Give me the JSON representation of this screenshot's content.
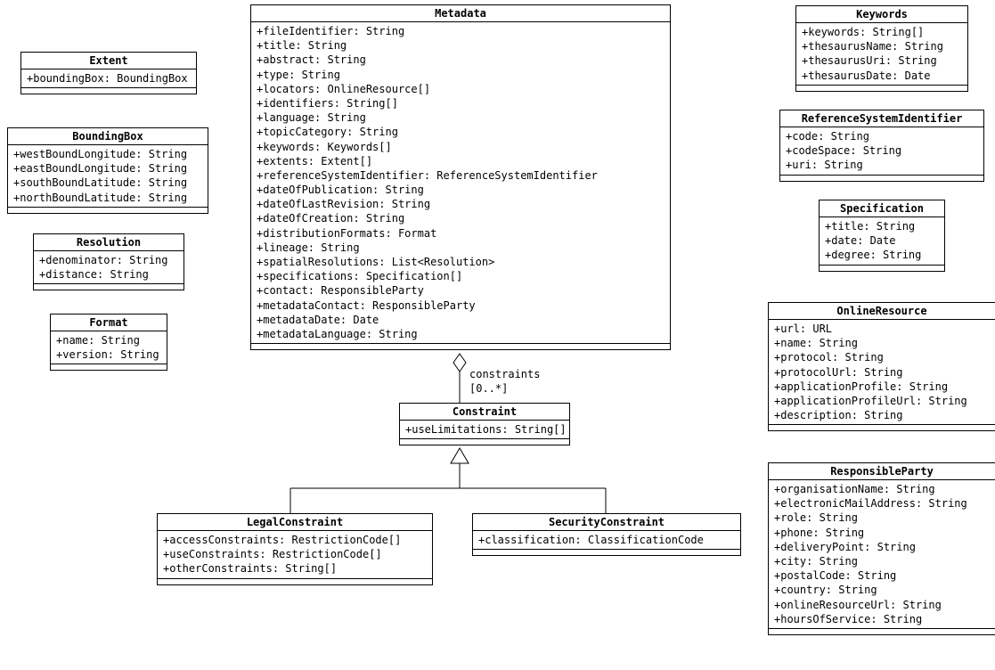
{
  "classes": {
    "metadata": {
      "name": "Metadata",
      "attrs": [
        "+fileIdentifier: String",
        "+title: String",
        "+abstract: String",
        "+type: String",
        "+locators: OnlineResource[]",
        "+identifiers: String[]",
        "+language: String",
        "+topicCategory: String",
        "+keywords: Keywords[]",
        "+extents: Extent[]",
        "+referenceSystemIdentifier: ReferenceSystemIdentifier",
        "+dateOfPublication: String",
        "+dateOfLastRevision: String",
        "+dateOfCreation: String",
        "+distributionFormats: Format",
        "+lineage: String",
        "+spatialResolutions: List<Resolution>",
        "+specifications: Specification[]",
        "+contact: ResponsibleParty",
        "+metadataContact: ResponsibleParty",
        "+metadataDate: Date",
        "+metadataLanguage: String"
      ]
    },
    "extent": {
      "name": "Extent",
      "attrs": [
        "+boundingBox: BoundingBox"
      ]
    },
    "boundingbox": {
      "name": "BoundingBox",
      "attrs": [
        "+westBoundLongitude: String",
        "+eastBoundLongitude: String",
        "+southBoundLatitude: String",
        "+northBoundLatitude: String"
      ]
    },
    "resolution": {
      "name": "Resolution",
      "attrs": [
        "+denominator: String",
        "+distance: String"
      ]
    },
    "format": {
      "name": "Format",
      "attrs": [
        "+name: String",
        "+version: String"
      ]
    },
    "constraint": {
      "name": "Constraint",
      "attrs": [
        "+useLimitations: String[]"
      ]
    },
    "legalconstraint": {
      "name": "LegalConstraint",
      "attrs": [
        "+accessConstraints: RestrictionCode[]",
        "+useConstraints: RestrictionCode[]",
        "+otherConstraints: String[]"
      ]
    },
    "securityconstraint": {
      "name": "SecurityConstraint",
      "attrs": [
        "+classification: ClassificationCode"
      ]
    },
    "keywords": {
      "name": "Keywords",
      "attrs": [
        "+keywords: String[]",
        "+thesaurusName: String",
        "+thesaurusUri: String",
        "+thesaurusDate: Date"
      ]
    },
    "refsys": {
      "name": "ReferenceSystemIdentifier",
      "attrs": [
        "+code: String",
        "+codeSpace: String",
        "+uri: String"
      ]
    },
    "specification": {
      "name": "Specification",
      "attrs": [
        "+title: String",
        "+date: Date",
        "+degree: String"
      ]
    },
    "onlineresource": {
      "name": "OnlineResource",
      "attrs": [
        "+url: URL",
        "+name: String",
        "+protocol: String",
        "+protocolUrl: String",
        "+applicationProfile: String",
        "+applicationProfileUrl: String",
        "+description: String"
      ]
    },
    "responsibleparty": {
      "name": "ResponsibleParty",
      "attrs": [
        "+organisationName: String",
        "+electronicMailAddress: String",
        "+role: String",
        "+phone: String",
        "+deliveryPoint: String",
        "+city: String",
        "+postalCode: String",
        "+country: String",
        "+onlineResourceUrl: String",
        "+hoursOfService: String"
      ]
    }
  },
  "association": {
    "label": "constraints",
    "multiplicity": "[0..*]"
  }
}
